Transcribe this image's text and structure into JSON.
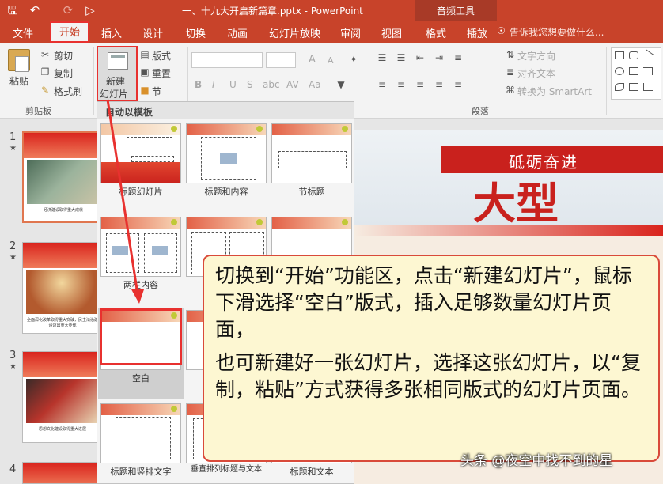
{
  "window": {
    "title": "一、十九大开启新篇章.pptx - PowerPoint",
    "context_tab_group": "音频工具"
  },
  "tabs": [
    "文件",
    "开始",
    "插入",
    "设计",
    "切换",
    "动画",
    "幻灯片放映",
    "审阅",
    "视图",
    "格式",
    "播放"
  ],
  "active_tab": "开始",
  "tell_me": "告诉我您想要做什么...",
  "ribbon": {
    "clipboard": {
      "paste": "粘贴",
      "cut": "剪切",
      "copy": "复制",
      "format_painter": "格式刷",
      "group_label": "剪贴板"
    },
    "slides": {
      "new_slide_line1": "新建",
      "new_slide_line2": "幻灯片",
      "layout": "版式",
      "reset": "重置",
      "section": "节"
    },
    "font": {
      "bold": "B",
      "italic": "I",
      "underline": "U",
      "shadow": "S",
      "strike": "abc",
      "spacing": "AV",
      "case": "Aa",
      "grow": "A",
      "shrink": "A"
    },
    "paragraph": {
      "text_direction": "文字方向",
      "align_text": "对齐文本",
      "smartart": "转换为 SmartArt",
      "group_label": "段落"
    }
  },
  "layout_gallery": {
    "header": "自动以模板",
    "layouts": [
      "标题幻灯片",
      "标题和内容",
      "节标题",
      "两栏内容",
      "空白",
      "标题和竖排文字",
      "垂直排列标题与文本",
      "标题和文本"
    ]
  },
  "slide_panel": {
    "slides": [
      {
        "number": "1",
        "caption": "经济建设取得重大成就"
      },
      {
        "number": "2",
        "caption": "全面深化改革取得重大突破，民主法治建设迈出重大步伐"
      },
      {
        "number": "3",
        "caption": "思想文化建设取得重大进展"
      },
      {
        "number": "4",
        "caption": ""
      }
    ],
    "star": "★"
  },
  "main_slide": {
    "banner_text": "砥砺奋进",
    "brush_text": "大型"
  },
  "callout": {
    "para1": "切换到“开始”功能区，点击“新建幻灯片”，鼠标下滑选择“空白”版式，插入足够数量幻灯片页面，",
    "para2": "也可新建好一张幻灯片，选择这张幻灯片，以“复制，粘贴”方式获得多张相同版式的幻灯片页面。"
  },
  "watermark": "头条 @夜空中找不到的星",
  "colors": {
    "ribbon_red": "#c8432a",
    "highlight_red": "#e8312f",
    "callout_bg": "#fdf7d2"
  }
}
